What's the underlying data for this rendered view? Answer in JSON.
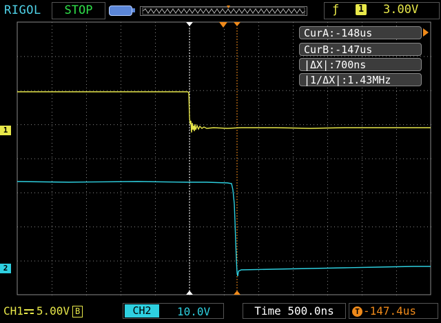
{
  "header": {
    "brand": "RIGOL",
    "run_state": "STOP",
    "trigger": {
      "edge_icon": "rising-edge-icon",
      "source": "1",
      "level": "3.00V"
    }
  },
  "cursors": {
    "cur_a": "CurA:-148us",
    "cur_b": "CurB:-147us",
    "delta_x": "|ΔX|:700ns",
    "inv_delta_x": "|1/ΔX|:1.43MHz"
  },
  "channels": {
    "ch1": {
      "marker": "1",
      "label": "CH1",
      "scale": "5.00V",
      "bw_badge": "B",
      "color": "#e8e84a"
    },
    "ch2": {
      "marker": "2",
      "label": "CH2",
      "scale": "10.0V",
      "color": "#2ed0e0"
    }
  },
  "footer": {
    "timebase": "Time 500.0ns",
    "trigger_position": "-147.4us"
  },
  "colors": {
    "ch1": "#e8e84a",
    "ch2": "#2ed0e0",
    "cursor_a": "#ffffff",
    "cursor_b": "#f08a1a",
    "grid": "#8a8a8a"
  }
}
